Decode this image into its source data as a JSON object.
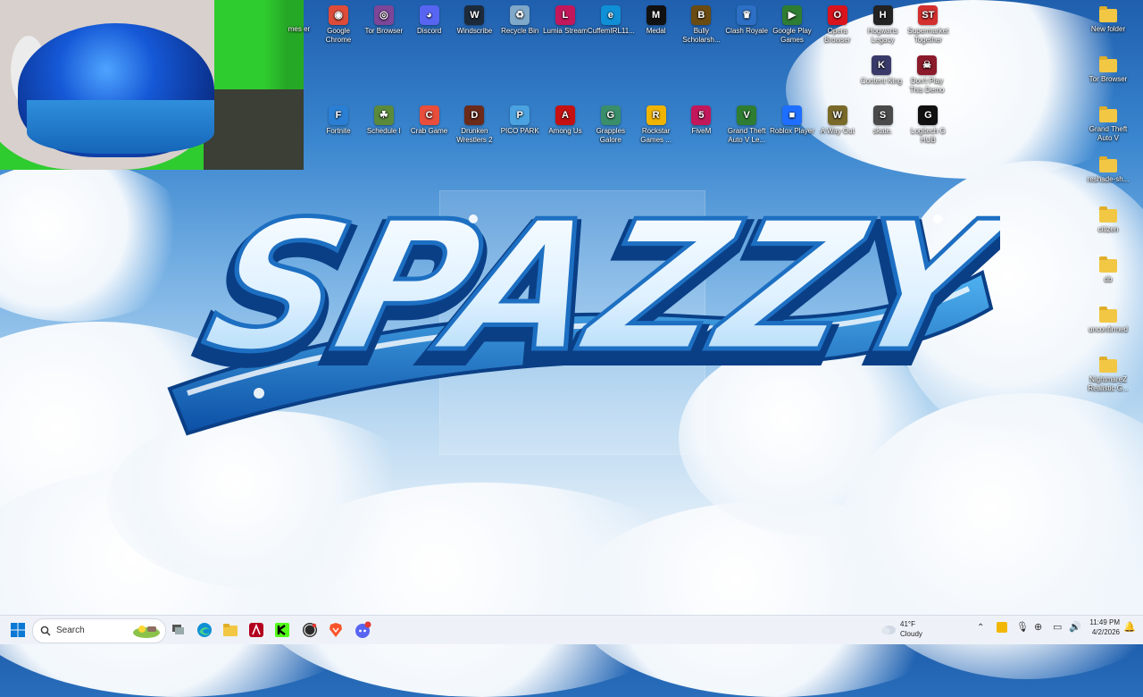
{
  "desktop": {
    "icons_row1": [
      {
        "label": "Google Chrome",
        "color": "#dd4b39",
        "glyph": "◉"
      },
      {
        "label": "Tor Browser",
        "color": "#7d4698",
        "glyph": "◎"
      },
      {
        "label": "Discord",
        "color": "#5865f2",
        "glyph": "◕"
      },
      {
        "label": "Windscribe",
        "color": "#1d2a3a",
        "glyph": "W"
      },
      {
        "label": "Recycle Bin",
        "color": "#7fa8c9",
        "glyph": "♻"
      },
      {
        "label": "Lumia Stream",
        "color": "#c2185b",
        "glyph": "L"
      },
      {
        "label": "CuffemIRL11...",
        "color": "#0f8fd6",
        "glyph": "e"
      },
      {
        "label": "Medal",
        "color": "#111111",
        "glyph": "M"
      },
      {
        "label": "Bully Scholarsh...",
        "color": "#6a4b12",
        "glyph": "B"
      },
      {
        "label": "Clash Royale",
        "color": "#2c6fc4",
        "glyph": "♛"
      },
      {
        "label": "Google Play Games",
        "color": "#2e7d32",
        "glyph": "▶"
      },
      {
        "label": "Opera Browser",
        "color": "#d9141c",
        "glyph": "O"
      },
      {
        "label": "Hogwarts Legacy",
        "color": "#232323",
        "glyph": "H"
      },
      {
        "label": "Supermarket Together",
        "color": "#d32f2f",
        "glyph": "ST"
      }
    ],
    "icons_row1b": [
      {
        "label": "Content King",
        "color": "#3a3a6a",
        "glyph": "K"
      },
      {
        "label": "Don't Play This Demo",
        "color": "#8b1a2a",
        "glyph": "☠"
      }
    ],
    "icons_row2": [
      {
        "label": "Fortnite",
        "color": "#2a7fd4",
        "glyph": "F"
      },
      {
        "label": "Schedule I",
        "color": "#5a8a3a",
        "glyph": "☘"
      },
      {
        "label": "Crab Game",
        "color": "#e94e3c",
        "glyph": "C"
      },
      {
        "label": "Drunken Wrestlers 2",
        "color": "#6b2a1a",
        "glyph": "D"
      },
      {
        "label": "PICO PARK",
        "color": "#4aa3e0",
        "glyph": "P"
      },
      {
        "label": "Among Us",
        "color": "#c51111",
        "glyph": "A"
      },
      {
        "label": "Grapples Galore",
        "color": "#3a8f6a",
        "glyph": "G"
      },
      {
        "label": "Rockstar Games ...",
        "color": "#f0b400",
        "glyph": "R"
      },
      {
        "label": "FiveM",
        "color": "#c2185b",
        "glyph": "5"
      },
      {
        "label": "Grand Theft Auto V Le...",
        "color": "#2e7d32",
        "glyph": "V"
      },
      {
        "label": "Roblox Player",
        "color": "#1e6fff",
        "glyph": "■"
      },
      {
        "label": "A Way Out",
        "color": "#7a6a2a",
        "glyph": "W"
      },
      {
        "label": "skate.",
        "color": "#4a4a4a",
        "glyph": "S"
      },
      {
        "label": "Logitech G HUB",
        "color": "#111111",
        "glyph": "G"
      }
    ],
    "partial_icon": {
      "label": "mes er"
    },
    "folders": [
      {
        "label": "New folder"
      },
      {
        "label": "Tor Browser"
      },
      {
        "label": "Grand Theft Auto V"
      },
      {
        "label": "reshade-sh..."
      },
      {
        "label": "citizen"
      },
      {
        "label": "db"
      },
      {
        "label": "unconfirmed"
      },
      {
        "label": "NightmareZ Realistic G..."
      }
    ],
    "wallpaper_text": "SPAZZY"
  },
  "taskbar": {
    "search_placeholder": "Search",
    "apps": [
      "start",
      "search",
      "task-view",
      "edge",
      "file-explorer",
      "adobe",
      "kick",
      "obs",
      "brave",
      "discord"
    ],
    "weather": {
      "temp": "41°F",
      "condition": "Cloudy"
    },
    "clock": {
      "time": "11:49 PM",
      "date": "4/2/2026"
    }
  }
}
